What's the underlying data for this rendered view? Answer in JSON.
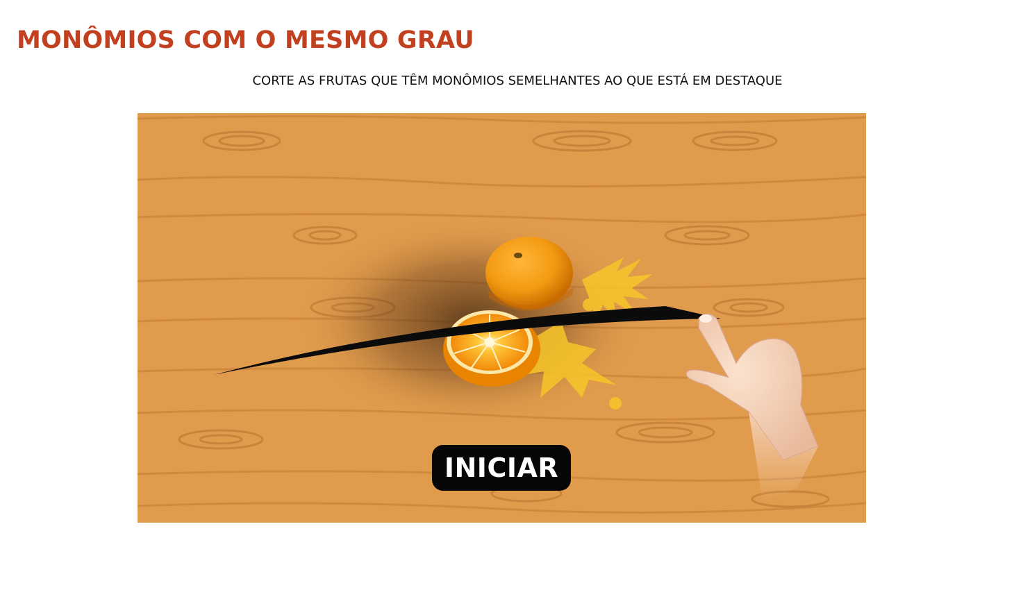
{
  "header": {
    "title": "MONÔMIOS COM O MESMO GRAU",
    "instruction": "CORTE AS FRUTAS QUE TÊM MONÔMIOS SEMELHANTES AO QUE ESTÁ EM DESTAQUE"
  },
  "game": {
    "start_label": "INICIAR",
    "icons": [
      "orange-whole-icon",
      "orange-half-icon",
      "juice-splash-icon",
      "slash-trail-icon",
      "pointing-hand-icon"
    ]
  },
  "colors": {
    "title": "#c1401f",
    "board": "#e19b4c",
    "button": "#060606"
  }
}
